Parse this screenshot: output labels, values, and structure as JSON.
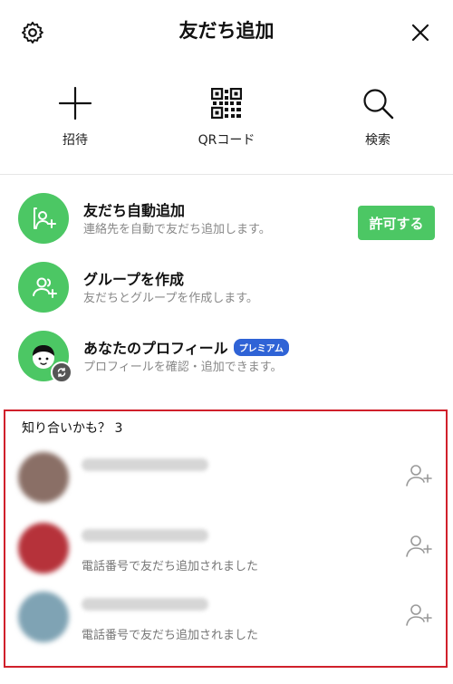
{
  "header": {
    "title": "友だち追加"
  },
  "actions": [
    {
      "label": "招待",
      "icon": "plus-icon"
    },
    {
      "label": "QRコード",
      "icon": "qr-code-icon"
    },
    {
      "label": "検索",
      "icon": "search-icon"
    }
  ],
  "rows": [
    {
      "title": "友だち自動追加",
      "subtitle": "連絡先を自動で友だち追加します。",
      "button": "許可する",
      "icon": "contact-add-icon"
    },
    {
      "title": "グループを作成",
      "subtitle": "友だちとグループを作成します。",
      "icon": "group-add-icon"
    },
    {
      "title": "あなたのプロフィール",
      "badge": "プレミアム",
      "subtitle": "プロフィールを確認・追加できます。",
      "icon": "profile-avatar-icon"
    }
  ],
  "suggestions": {
    "title": "知り合いかも？ 3",
    "items": [
      {
        "subtitle": "",
        "avatar_color": "#8a6f66"
      },
      {
        "subtitle": "電話番号で友だち追加されました",
        "avatar_color": "#b6323a"
      },
      {
        "subtitle": "電話番号で友だち追加されました",
        "avatar_color": "#7fa3b4"
      }
    ]
  },
  "colors": {
    "accent": "#4cc764",
    "highlight_border": "#d0202b",
    "premium": "#2f63d6"
  }
}
